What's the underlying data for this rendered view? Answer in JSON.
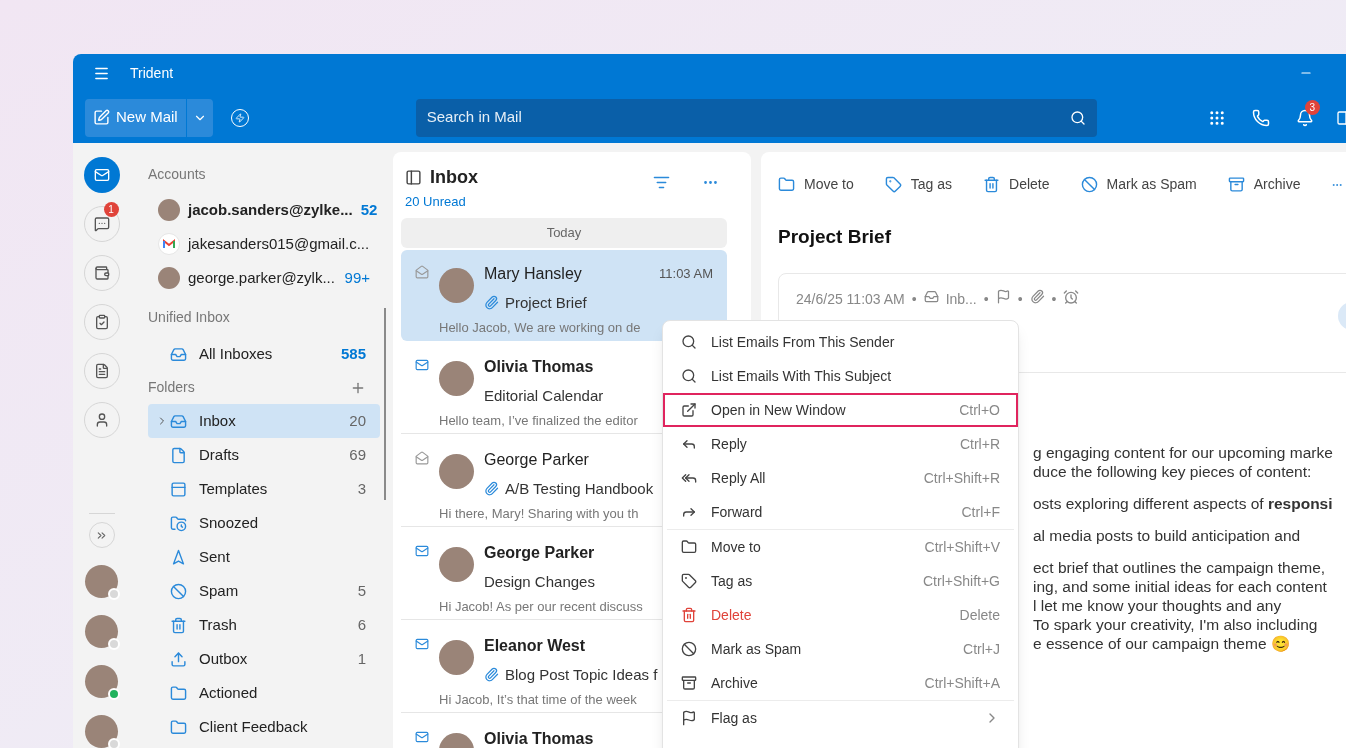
{
  "window": {
    "title": "Trident"
  },
  "toolbar": {
    "new_mail": "New Mail",
    "search": {
      "placeholder": "Search in Mail"
    },
    "notification_count": "3"
  },
  "rail": {
    "items": [
      {
        "selected": true
      },
      {
        "selected": false,
        "badge": "1"
      },
      {
        "selected": false
      },
      {
        "selected": false
      },
      {
        "selected": false
      },
      {
        "selected": false
      }
    ],
    "contacts": [
      {
        "online": false
      },
      {
        "online": false
      },
      {
        "online": true
      },
      {
        "online": false
      }
    ]
  },
  "folders_pane": {
    "accounts_heading": "Accounts",
    "accounts": [
      {
        "kind": "avatar",
        "name": "jacob.sanders@zylke...",
        "count": "52",
        "active": true
      },
      {
        "kind": "gmail",
        "name": "jakesanders015@gmail.c...",
        "active": false
      },
      {
        "kind": "avatar",
        "name": "george.parker@zylk...",
        "count": "99+",
        "active": false
      }
    ],
    "unified_heading": "Unified Inbox",
    "all_inboxes": {
      "label": "All Inboxes",
      "count": "585"
    },
    "folders_heading": "Folders",
    "folders": [
      {
        "label": "Inbox",
        "count": "20",
        "selected": true,
        "expandable": true
      },
      {
        "label": "Drafts",
        "count": "69",
        "selected": false,
        "expandable": false
      },
      {
        "label": "Templates",
        "count": "3",
        "selected": false,
        "expandable": false
      },
      {
        "label": "Snoozed",
        "selected": false,
        "expandable": false
      },
      {
        "label": "Sent",
        "selected": false,
        "expandable": false
      },
      {
        "label": "Spam",
        "count": "5",
        "selected": false,
        "expandable": false
      },
      {
        "label": "Trash",
        "count": "6",
        "selected": false,
        "expandable": false
      },
      {
        "label": "Outbox",
        "count": "1",
        "selected": false,
        "expandable": false
      },
      {
        "label": "Actioned",
        "selected": false,
        "expandable": false
      },
      {
        "label": "Client Feedback",
        "selected": false,
        "expandable": false
      }
    ]
  },
  "mail_list": {
    "title": "Inbox",
    "unread_label": "20 Unread",
    "group": "Today",
    "messages": [
      {
        "sender": "Mary Hansley",
        "time": "11:03 AM",
        "subject": "Project Brief",
        "preview": "Hello Jacob, We are working on de",
        "unread": false,
        "attachment": true,
        "selected": true
      },
      {
        "sender": "Olivia Thomas",
        "subject": "Editorial Calendar",
        "preview": "Hello team, I’ve finalized the editor",
        "unread": true,
        "attachment": false,
        "selected": false
      },
      {
        "sender": "George Parker",
        "subject": "A/B Testing Handbook",
        "preview": "Hi there, Mary! Sharing with you th",
        "unread": false,
        "attachment": true,
        "selected": false
      },
      {
        "sender": "George Parker",
        "subject": "Design Changes",
        "preview": "Hi Jacob! As per our recent discuss",
        "unread": true,
        "attachment": false,
        "selected": false
      },
      {
        "sender": "Eleanor West",
        "subject": "Blog Post Topic Ideas f",
        "preview": "Hi Jacob, It’s that time of the week",
        "unread": true,
        "attachment": true,
        "selected": false
      },
      {
        "sender": "Olivia Thomas",
        "unread": true,
        "selected": false
      }
    ]
  },
  "reading_pane": {
    "actions": [
      "Move to",
      "Tag as",
      "Delete",
      "Mark as Spam",
      "Archive"
    ],
    "subject": "Project Brief",
    "date": "24/6/25 11:03 AM",
    "folder": "Inb...",
    "separator": "•",
    "body": [
      [
        "g engaging content for our upcoming marke",
        "duce the following key pieces of content:"
      ],
      [
        "osts exploring different aspects of **responsi**"
      ],
      [
        "al media posts to build anticipation and"
      ],
      [
        "ect brief that outlines the campaign theme,",
        "ing, and some initial ideas for each content",
        "l let me know your thoughts and any",
        "To spark your creativity, I'm also including",
        "e essence of our campaign theme 😊"
      ]
    ]
  },
  "context_menu": {
    "groups": [
      [
        {
          "label": "List Emails From This Sender",
          "danger": false,
          "highlighted": false,
          "submenu": false
        },
        {
          "label": "List Emails With This Subject",
          "danger": false,
          "highlighted": false,
          "submenu": false
        },
        {
          "label": "Open in New Window",
          "shortcut": "Ctrl+O",
          "danger": false,
          "highlighted": true,
          "submenu": false
        },
        {
          "label": "Reply",
          "shortcut": "Ctrl+R",
          "danger": false,
          "highlighted": false,
          "submenu": false
        },
        {
          "label": "Reply All",
          "shortcut": "Ctrl+Shift+R",
          "danger": false,
          "highlighted": false,
          "submenu": false
        },
        {
          "label": "Forward",
          "shortcut": "Ctrl+F",
          "danger": false,
          "highlighted": false,
          "submenu": false
        }
      ],
      [
        {
          "label": "Move to",
          "shortcut": "Ctrl+Shift+V",
          "danger": false,
          "highlighted": false,
          "submenu": false
        },
        {
          "label": "Tag as",
          "shortcut": "Ctrl+Shift+G",
          "danger": false,
          "highlighted": false,
          "submenu": false
        },
        {
          "label": "Delete",
          "shortcut": "Delete",
          "danger": true,
          "highlighted": false,
          "submenu": false
        },
        {
          "label": "Mark as Spam",
          "shortcut": "Ctrl+J",
          "danger": false,
          "highlighted": false,
          "submenu": false
        },
        {
          "label": "Archive",
          "shortcut": "Ctrl+Shift+A",
          "danger": false,
          "highlighted": false,
          "submenu": false
        }
      ],
      [
        {
          "label": "Flag as",
          "danger": false,
          "highlighted": false,
          "submenu": true
        }
      ]
    ]
  }
}
